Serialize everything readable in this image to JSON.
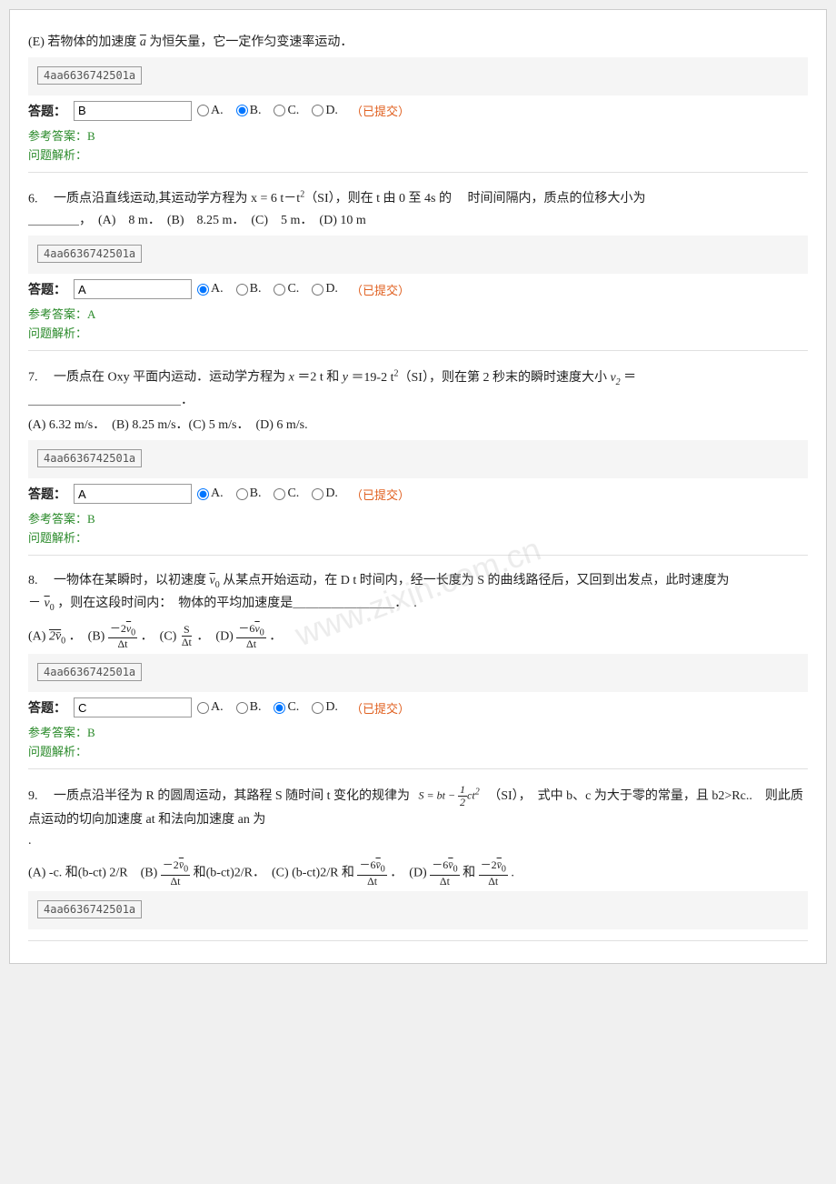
{
  "watermark": "www.zixin.com.cn",
  "questions": [
    {
      "id": "q5",
      "prefix": "(E)",
      "text": "若物体的加速度 ",
      "vector": "a",
      "text2": " 为恒矢量，它一定作匀变速率运动．",
      "answer_id": "4aa6636742501a",
      "answer_value": "B",
      "options": [
        "A.",
        "B.",
        "C.",
        "D."
      ],
      "selected": "B",
      "submitted": "已提交",
      "ref_answer": "参考答案：B",
      "analysis": "问题解析："
    },
    {
      "id": "q6",
      "prefix": "6.",
      "text": "　一质点沿直线运动,其运动学方程为 x = 6 t－t2（SI），则在 t 由 0 至 4s 的　 时间间隔内，质点的位移大小为",
      "text2": "＿＿＿＿，　(A)　8 m．　(B)　8.25 m．　(C)　5 m．　(D) 10 m",
      "answer_id": "4aa6636742501a",
      "answer_value": "A",
      "options": [
        "A.",
        "B.",
        "C.",
        "D."
      ],
      "selected": "A",
      "submitted": "已提交",
      "ref_answer": "参考答案：A",
      "analysis": "问题解析："
    },
    {
      "id": "q7",
      "prefix": "7.",
      "text": "　一质点在 Oxy 平面内运动．运动学方程为",
      "eq1": "x＝2 t",
      "text_and": "和",
      "eq2": "y＝19-2 t2（SI），则在第 2 秒末的瞬时速度大小",
      "v2": "v₂",
      "eq3": "＝",
      "text3": "＿＿＿＿＿＿＿＿＿＿＿＿．",
      "options_text": "(A) 6.32 m/s．　(B) 8.25 m/s．(C) 5 m/s．　(D) 6 m/s.",
      "answer_id": "4aa6636742501a",
      "answer_value": "A",
      "options": [
        "A.",
        "B.",
        "C.",
        "D."
      ],
      "selected": "A",
      "submitted": "已提交",
      "ref_answer": "参考答案：B",
      "analysis": "问题解析："
    },
    {
      "id": "q8",
      "prefix": "8.",
      "text1": "　一物体在某瞬时，以初速度",
      "v0": "v₀",
      "text2": " 从某点开始运动，在 D t 时间内，经一长度为 S 的曲线路径后，又回到出发点，此时速度为",
      "text3": "－",
      "v0b": "v₀",
      "text4": "，则在这段时间内：　物体的平均加速度是＿＿＿＿＿＿＿＿．　.",
      "options_text1": "(A)",
      "opt_a_frac_n": "2v̄₀",
      "text_b": "(B)",
      "opt_b_frac_n": "－2v̄₀",
      "opt_b_frac_d": "Δt",
      "text_c": "(C)",
      "opt_c_frac_n": "S",
      "opt_c_frac_d": "Δt",
      "text_d": "(D)",
      "opt_d_frac_n": "－6v̄₀",
      "opt_d_frac_d": "Δt",
      "answer_id": "4aa6636742501a",
      "answer_value": "C",
      "options": [
        "A.",
        "B.",
        "C.",
        "D."
      ],
      "selected": "C",
      "submitted": "已提交",
      "ref_answer": "参考答案：B",
      "analysis": "问题解析："
    },
    {
      "id": "q9",
      "prefix": "9.",
      "text1": "　一质点沿半径为 R 的圆周运动，其路程 S 随时间 t 变化的规律为",
      "formula": "S = bt - ½ct²",
      "text2": "（SI），　式中 b、c 为大于零的常量，且 b2>Rc..　则此质点运动的切向加速度 at 和法向加速度 an 为",
      "text3": ".",
      "opts_text": "(A) -c. 和(b-ct) 2/R　(B)",
      "opt_b_n": "－2v̄₀",
      "opt_b_d": "Δt",
      "text_b2": "和(b-ct)2/R．　(C) (b-ct)2/R 和",
      "opt_c_n": "－6v̄₀",
      "opt_c_d": "Δt",
      "text_d2": "．　(D)",
      "opt_d1_n": "－6v̄₀",
      "opt_d1_d": "Δt",
      "text_and2": "和",
      "opt_d2_n": "－2v̄₀",
      "opt_d2_d": "Δt",
      "text_end": ".",
      "answer_id": "4aa6636742501a"
    }
  ],
  "labels": {
    "answer": "答题：",
    "ref_prefix": "参考答案：",
    "analysis_label": "问题解析："
  }
}
